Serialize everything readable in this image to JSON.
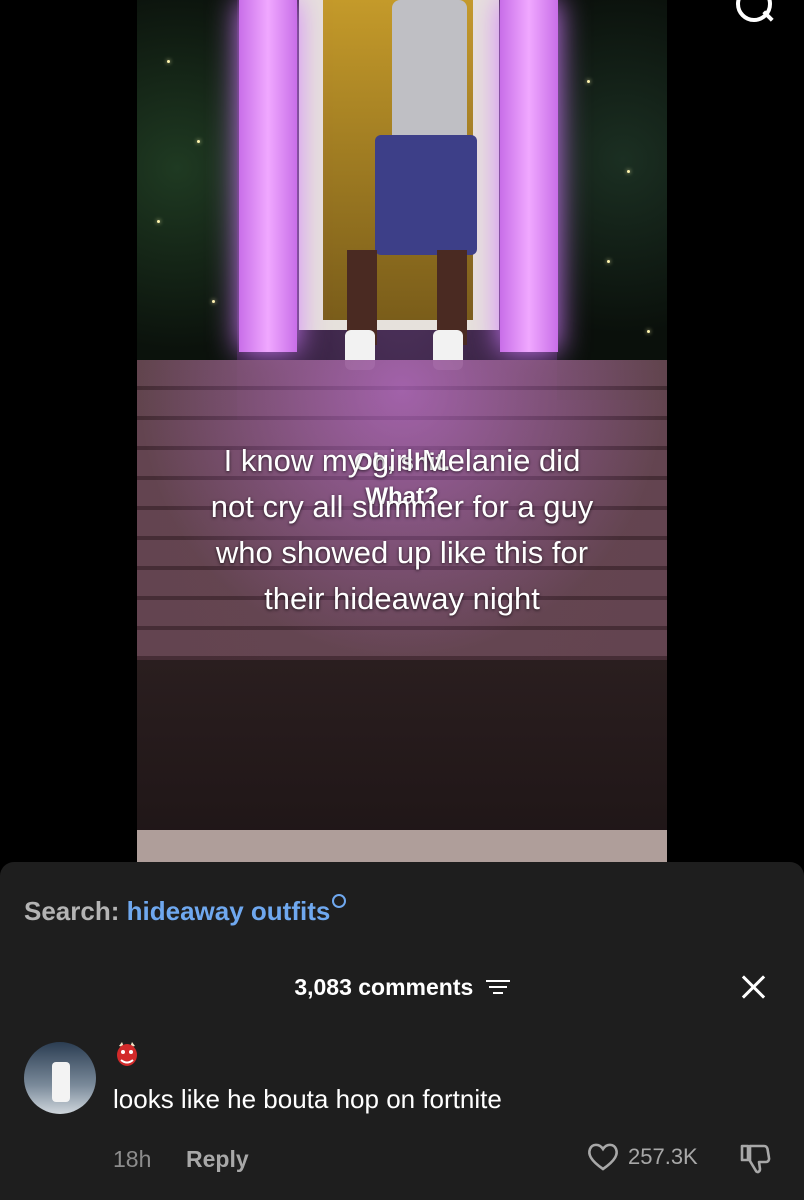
{
  "video": {
    "caption_lines": [
      "I know my girl Melanie did",
      "not cry all summer for a guy",
      "who showed up like this for",
      "their hideaway night"
    ],
    "subtitle_lines": [
      "Oh, shit.",
      "What?"
    ]
  },
  "icons": {
    "top_search": "search-icon",
    "filter": "sort-icon",
    "close": "close-icon",
    "like": "heart-icon",
    "dislike": "thumbs-down-icon",
    "emoji": "goblin-mask-emoji"
  },
  "sheet": {
    "search_label": "Search:",
    "search_term": "hideaway outfits",
    "comments_count": "3,083 comments",
    "comment": {
      "text": "looks like he bouta hop on fortnite",
      "time": "18h",
      "reply_label": "Reply",
      "likes": "257.3K"
    }
  },
  "colors": {
    "sheet_bg": "#1e1e1e",
    "search_term": "#6fa8ef",
    "muted": "#8d8d8d"
  }
}
